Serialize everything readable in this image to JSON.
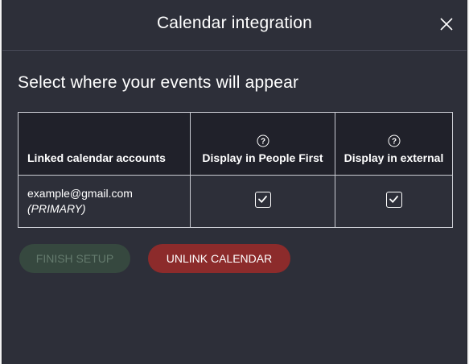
{
  "dialog": {
    "title": "Calendar integration",
    "heading": "Select where your events will appear"
  },
  "table": {
    "headers": {
      "accounts": "Linked calendar accounts",
      "people_first": "Display in People First",
      "external": "Display in external"
    },
    "rows": [
      {
        "email": "example@gmail.com",
        "label": "(PRIMARY)",
        "display_people_first": true,
        "display_external": true
      }
    ]
  },
  "buttons": {
    "finish": "FINISH SETUP",
    "unlink": "UNLINK CALENDAR"
  },
  "icons": {
    "close": "close-icon",
    "help": "help-circle-icon",
    "check": "checkmark-icon"
  },
  "colors": {
    "background": "#2d2f39",
    "table_header": "#20212a",
    "finish_button": "#36483f",
    "unlink_button": "#8c2b2b"
  }
}
